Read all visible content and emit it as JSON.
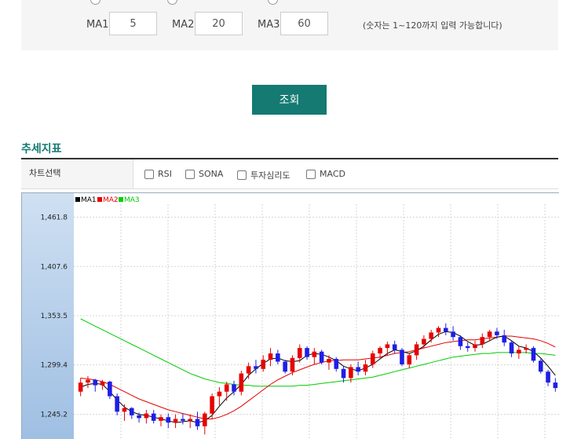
{
  "ma": {
    "items": [
      {
        "label": "MA1",
        "value": "5"
      },
      {
        "label": "MA2",
        "value": "20"
      },
      {
        "label": "MA3",
        "value": "60"
      }
    ],
    "hint": "(숫자는 1~120까지 입력 가능합니다)"
  },
  "search_button": "조회",
  "section_title": "추세지표",
  "indicator": {
    "header": "차트선택",
    "options": [
      "RSI",
      "SONA",
      "투자심리도",
      "MACD"
    ]
  },
  "colors": {
    "accent": "#147a72",
    "up": "#e60000",
    "down": "#1e1ee6",
    "ma1": "#000000",
    "ma2": "#e60000",
    "ma3": "#00cc00"
  },
  "chart_data": {
    "type": "candlestick",
    "legend": [
      "MA1",
      "MA2",
      "MA3"
    ],
    "y_ticks": [
      "1,461.8",
      "1,407.6",
      "1,353.5",
      "1,299.4",
      "1,245.2"
    ],
    "ylim": [
      1218,
      1476
    ],
    "candles": [
      [
        1270,
        1285,
        1265,
        1280
      ],
      [
        1280,
        1287,
        1274,
        1283
      ],
      [
        1283,
        1284,
        1270,
        1277
      ],
      [
        1277,
        1283,
        1272,
        1281
      ],
      [
        1281,
        1282,
        1262,
        1265
      ],
      [
        1265,
        1268,
        1244,
        1248
      ],
      [
        1248,
        1256,
        1238,
        1252
      ],
      [
        1252,
        1253,
        1240,
        1244
      ],
      [
        1244,
        1247,
        1236,
        1241
      ],
      [
        1241,
        1250,
        1235,
        1246
      ],
      [
        1246,
        1250,
        1235,
        1238
      ],
      [
        1238,
        1245,
        1232,
        1242
      ],
      [
        1242,
        1246,
        1230,
        1236
      ],
      [
        1236,
        1245,
        1230,
        1240
      ],
      [
        1240,
        1246,
        1234,
        1238
      ],
      [
        1238,
        1245,
        1230,
        1240
      ],
      [
        1240,
        1248,
        1228,
        1232
      ],
      [
        1232,
        1248,
        1223,
        1246
      ],
      [
        1246,
        1268,
        1240,
        1265
      ],
      [
        1265,
        1275,
        1255,
        1270
      ],
      [
        1270,
        1281,
        1260,
        1278
      ],
      [
        1278,
        1282,
        1266,
        1270
      ],
      [
        1270,
        1293,
        1266,
        1290
      ],
      [
        1290,
        1302,
        1284,
        1298
      ],
      [
        1298,
        1305,
        1290,
        1295
      ],
      [
        1295,
        1310,
        1292,
        1305
      ],
      [
        1305,
        1318,
        1298,
        1312
      ],
      [
        1312,
        1316,
        1300,
        1303
      ],
      [
        1303,
        1305,
        1290,
        1292
      ],
      [
        1292,
        1310,
        1288,
        1307
      ],
      [
        1307,
        1322,
        1302,
        1318
      ],
      [
        1318,
        1320,
        1305,
        1308
      ],
      [
        1308,
        1318,
        1300,
        1314
      ],
      [
        1314,
        1316,
        1300,
        1302
      ],
      [
        1302,
        1310,
        1294,
        1306
      ],
      [
        1306,
        1308,
        1292,
        1295
      ],
      [
        1295,
        1298,
        1280,
        1285
      ],
      [
        1285,
        1300,
        1280,
        1297
      ],
      [
        1297,
        1303,
        1288,
        1292
      ],
      [
        1292,
        1305,
        1288,
        1300
      ],
      [
        1300,
        1315,
        1296,
        1312
      ],
      [
        1312,
        1320,
        1306,
        1318
      ],
      [
        1318,
        1325,
        1310,
        1322
      ],
      [
        1322,
        1326,
        1312,
        1316
      ],
      [
        1316,
        1318,
        1298,
        1300
      ],
      [
        1300,
        1312,
        1296,
        1310
      ],
      [
        1310,
        1325,
        1305,
        1322
      ],
      [
        1322,
        1332,
        1318,
        1328
      ],
      [
        1328,
        1338,
        1324,
        1335
      ],
      [
        1335,
        1342,
        1330,
        1340
      ],
      [
        1340,
        1345,
        1332,
        1336
      ],
      [
        1336,
        1342,
        1326,
        1330
      ],
      [
        1330,
        1332,
        1316,
        1320
      ],
      [
        1320,
        1324,
        1314,
        1318
      ],
      [
        1318,
        1326,
        1314,
        1322
      ],
      [
        1322,
        1334,
        1318,
        1330
      ],
      [
        1330,
        1338,
        1326,
        1336
      ],
      [
        1336,
        1340,
        1328,
        1332
      ],
      [
        1332,
        1338,
        1320,
        1324
      ],
      [
        1324,
        1326,
        1308,
        1312
      ],
      [
        1312,
        1320,
        1306,
        1316
      ],
      [
        1316,
        1322,
        1312,
        1318
      ],
      [
        1318,
        1320,
        1302,
        1304
      ],
      [
        1304,
        1306,
        1290,
        1292
      ],
      [
        1292,
        1294,
        1276,
        1280
      ],
      [
        1280,
        1285,
        1270,
        1274
      ]
    ],
    "ma1": [
      1275,
      1278,
      1279,
      1278,
      1270,
      1261,
      1253,
      1248,
      1245,
      1244,
      1242,
      1240,
      1238,
      1236,
      1237,
      1238,
      1236,
      1238,
      1244,
      1254,
      1263,
      1270,
      1278,
      1288,
      1295,
      1301,
      1306,
      1307,
      1304,
      1303,
      1304,
      1310,
      1312,
      1311,
      1308,
      1304,
      1298,
      1295,
      1293,
      1296,
      1300,
      1306,
      1312,
      1316,
      1314,
      1312,
      1315,
      1320,
      1327,
      1333,
      1336,
      1335,
      1331,
      1325,
      1321,
      1322,
      1326,
      1330,
      1331,
      1326,
      1320,
      1318,
      1314,
      1307,
      1298,
      1288
    ],
    "ma2": [
      1285,
      1284,
      1283,
      1281,
      1278,
      1274,
      1270,
      1266,
      1262,
      1259,
      1256,
      1253,
      1250,
      1248,
      1246,
      1244,
      1242,
      1240,
      1240,
      1242,
      1245,
      1249,
      1254,
      1260,
      1266,
      1272,
      1278,
      1283,
      1287,
      1291,
      1294,
      1297,
      1300,
      1302,
      1304,
      1304,
      1305,
      1305,
      1305,
      1306,
      1307,
      1308,
      1310,
      1312,
      1313,
      1314,
      1316,
      1318,
      1320,
      1322,
      1324,
      1325,
      1326,
      1327,
      1327,
      1328,
      1329,
      1330,
      1331,
      1331,
      1330,
      1329,
      1328,
      1326,
      1323,
      1319
    ],
    "ma3": [
      1350,
      1346,
      1342,
      1338,
      1334,
      1330,
      1326,
      1322,
      1318,
      1314,
      1310,
      1306,
      1302,
      1298,
      1294,
      1290,
      1287,
      1284,
      1282,
      1280,
      1279,
      1278,
      1277,
      1277,
      1276,
      1276,
      1276,
      1276,
      1276,
      1276,
      1277,
      1277,
      1278,
      1279,
      1280,
      1281,
      1282,
      1283,
      1284,
      1285,
      1286,
      1288,
      1290,
      1292,
      1294,
      1296,
      1298,
      1300,
      1302,
      1304,
      1306,
      1308,
      1309,
      1310,
      1311,
      1312,
      1312,
      1313,
      1313,
      1313,
      1313,
      1313,
      1312,
      1312,
      1311,
      1310
    ]
  }
}
